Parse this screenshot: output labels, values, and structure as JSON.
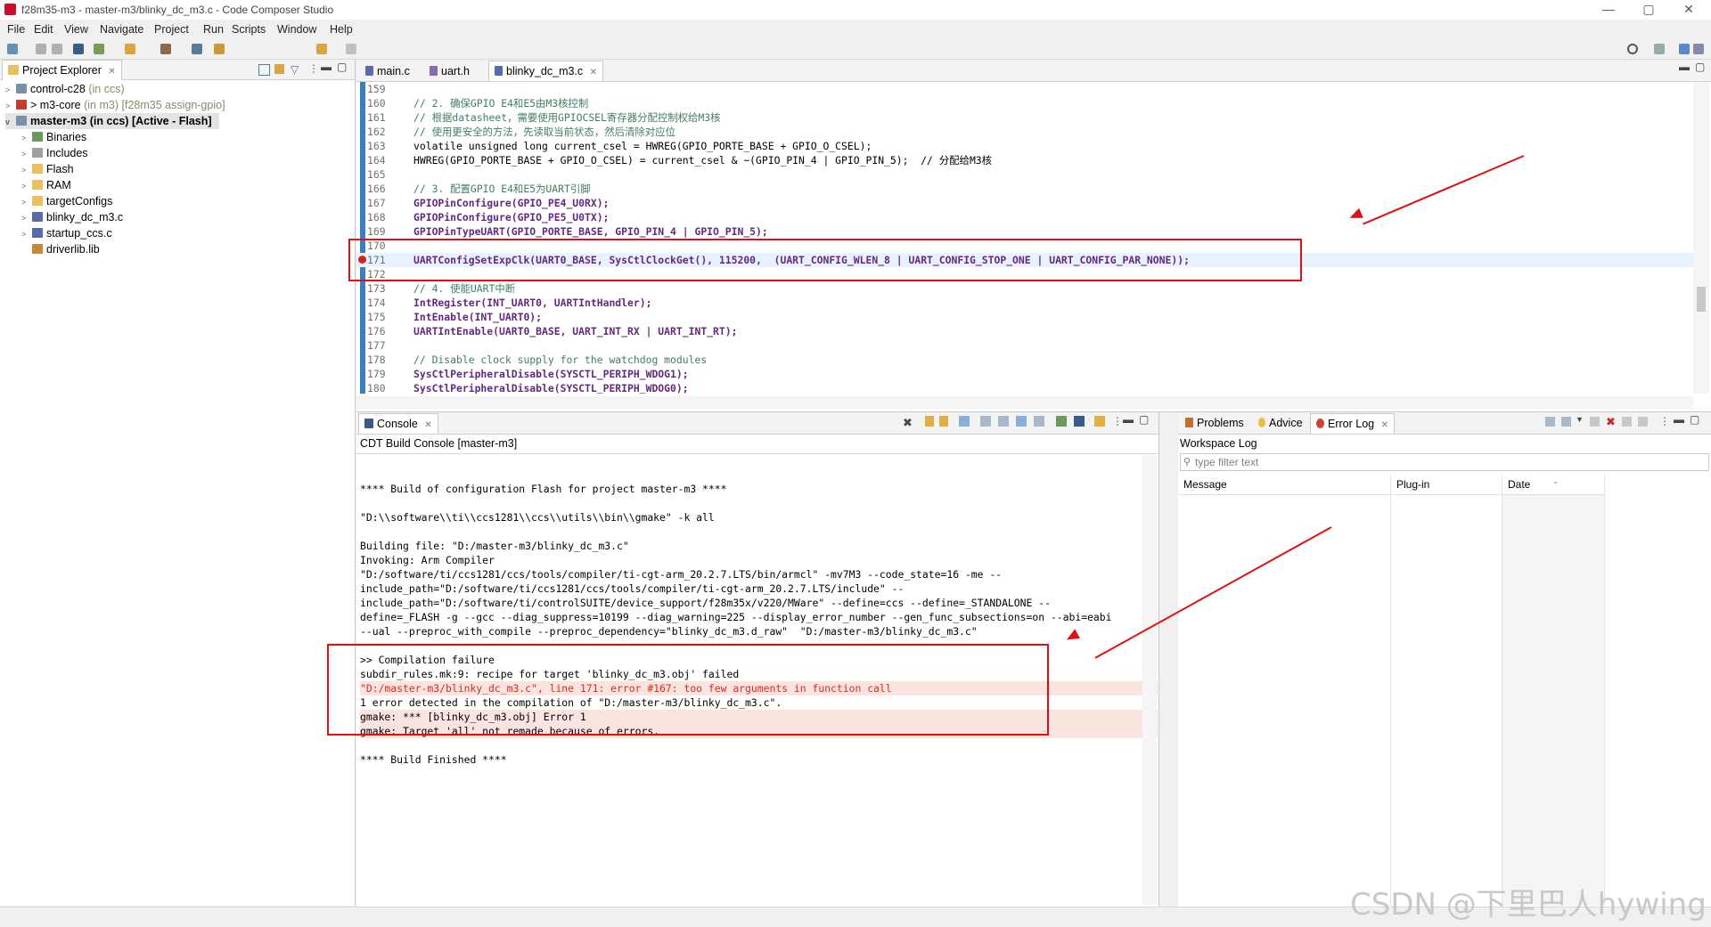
{
  "window": {
    "title": "f28m35-m3 - master-m3/blinky_dc_m3.c - Code Composer Studio"
  },
  "menu": [
    "File",
    "Edit",
    "View",
    "Navigate",
    "Project",
    "Run",
    "Scripts",
    "Window",
    "Help"
  ],
  "project_explorer": {
    "tab_label": "Project Explorer",
    "items": [
      {
        "name": "control-c28",
        "suffix": "(in ccs)",
        "extra": ""
      },
      {
        "name": "> m3-core",
        "suffix": "(in m3)",
        "extra": "[f28m35 assign-gpio]"
      },
      {
        "name": "master-m3 (in ccs)",
        "suffix": "",
        "extra": "[Active - Flash]"
      },
      {
        "name": "Binaries"
      },
      {
        "name": "Includes"
      },
      {
        "name": "Flash"
      },
      {
        "name": "RAM"
      },
      {
        "name": "targetConfigs"
      },
      {
        "name": "blinky_dc_m3.c"
      },
      {
        "name": "startup_ccs.c"
      },
      {
        "name": "driverlib.lib"
      }
    ]
  },
  "editor": {
    "tabs": [
      "main.c",
      "uart.h",
      "blinky_dc_m3.c"
    ],
    "lines": [
      {
        "n": "159",
        "t": ""
      },
      {
        "n": "160",
        "t": "// 2. 确保GPIO E4和E5由M3核控制"
      },
      {
        "n": "161",
        "t": "// 根据datasheet，需要使用GPIOCSEL寄存器分配控制权给M3核"
      },
      {
        "n": "162",
        "t": "// 使用更安全的方法，先读取当前状态，然后清除对应位"
      },
      {
        "n": "163",
        "t": "volatile unsigned long current_csel = HWREG(GPIO_PORTE_BASE + GPIO_O_CSEL);"
      },
      {
        "n": "164",
        "t": "HWREG(GPIO_PORTE_BASE + GPIO_O_CSEL) = current_csel & ~(GPIO_PIN_4 | GPIO_PIN_5);  // 分配给M3核"
      },
      {
        "n": "165",
        "t": ""
      },
      {
        "n": "166",
        "t": "// 3. 配置GPIO E4和E5为UART引脚"
      },
      {
        "n": "167",
        "t": "GPIOPinConfigure(GPIO_PE4_U0RX);"
      },
      {
        "n": "168",
        "t": "GPIOPinConfigure(GPIO_PE5_U0TX);"
      },
      {
        "n": "169",
        "t": "GPIOPinTypeUART(GPIO_PORTE_BASE, GPIO_PIN_4 | GPIO_PIN_5);"
      },
      {
        "n": "170",
        "t": ""
      },
      {
        "n": "171",
        "t": "UARTConfigSetExpClk(UART0_BASE, SysCtlClockGet(), 115200,  (UART_CONFIG_WLEN_8 | UART_CONFIG_STOP_ONE | UART_CONFIG_PAR_NONE));"
      },
      {
        "n": "172",
        "t": ""
      },
      {
        "n": "173",
        "t": "// 4. 使能UART中断"
      },
      {
        "n": "174",
        "t": "IntRegister(INT_UART0, UARTIntHandler);"
      },
      {
        "n": "175",
        "t": "IntEnable(INT_UART0);"
      },
      {
        "n": "176",
        "t": "UARTIntEnable(UART0_BASE, UART_INT_RX | UART_INT_RT);"
      },
      {
        "n": "177",
        "t": ""
      },
      {
        "n": "178",
        "t": "// Disable clock supply for the watchdog modules"
      },
      {
        "n": "179",
        "t": "SysCtlPeripheralDisable(SYSCTL_PERIPH_WDOG1);"
      },
      {
        "n": "180",
        "t": "SysCtlPeripheralDisable(SYSCTL_PERIPH_WDOG0);"
      }
    ]
  },
  "console": {
    "tab_label": "Console",
    "title": "CDT Build Console [master-m3]",
    "lines": [
      "",
      "**** Build of configuration Flash for project master-m3 ****",
      "",
      "\"D:\\\\software\\\\ti\\\\ccs1281\\\\ccs\\\\utils\\\\bin\\\\gmake\" -k all",
      "",
      "Building file: \"D:/master-m3/blinky_dc_m3.c\"",
      "Invoking: Arm Compiler",
      "\"D:/software/ti/ccs1281/ccs/tools/compiler/ti-cgt-arm_20.2.7.LTS/bin/armcl\" -mv7M3 --code_state=16 -me --",
      "include_path=\"D:/software/ti/ccs1281/ccs/tools/compiler/ti-cgt-arm_20.2.7.LTS/include\" --",
      "include_path=\"D:/software/ti/controlSUITE/device_support/f28m35x/v220/MWare\" --define=ccs --define=_STANDALONE --",
      "define=_FLASH -g --gcc --diag_suppress=10199 --diag_warning=225 --display_error_number --gen_func_subsections=on --abi=eabi",
      "--ual --preproc_with_compile --preproc_dependency=\"blinky_dc_m3.d_raw\"  \"D:/master-m3/blinky_dc_m3.c\"",
      "",
      ">> Compilation failure",
      "subdir_rules.mk:9: recipe for target 'blinky_dc_m3.obj' failed",
      "\"D:/master-m3/blinky_dc_m3.c\", line 171: error #167: too few arguments in function call",
      "1 error detected in the compilation of \"D:/master-m3/blinky_dc_m3.c\".",
      "gmake: *** [blinky_dc_m3.obj] Error 1",
      "gmake: Target 'all' not remade because of errors.",
      "",
      "**** Build Finished ****"
    ]
  },
  "right_panel": {
    "tabs": [
      "Problems",
      "Advice",
      "Error Log"
    ],
    "title": "Workspace Log",
    "filter_placeholder": "type filter text",
    "columns": [
      "Message",
      "Plug-in",
      "Date"
    ]
  },
  "watermark": "CSDN @下里巴人hywing",
  "colors": {
    "annotation_red": "#e01010",
    "error_text": "#e0281a"
  }
}
